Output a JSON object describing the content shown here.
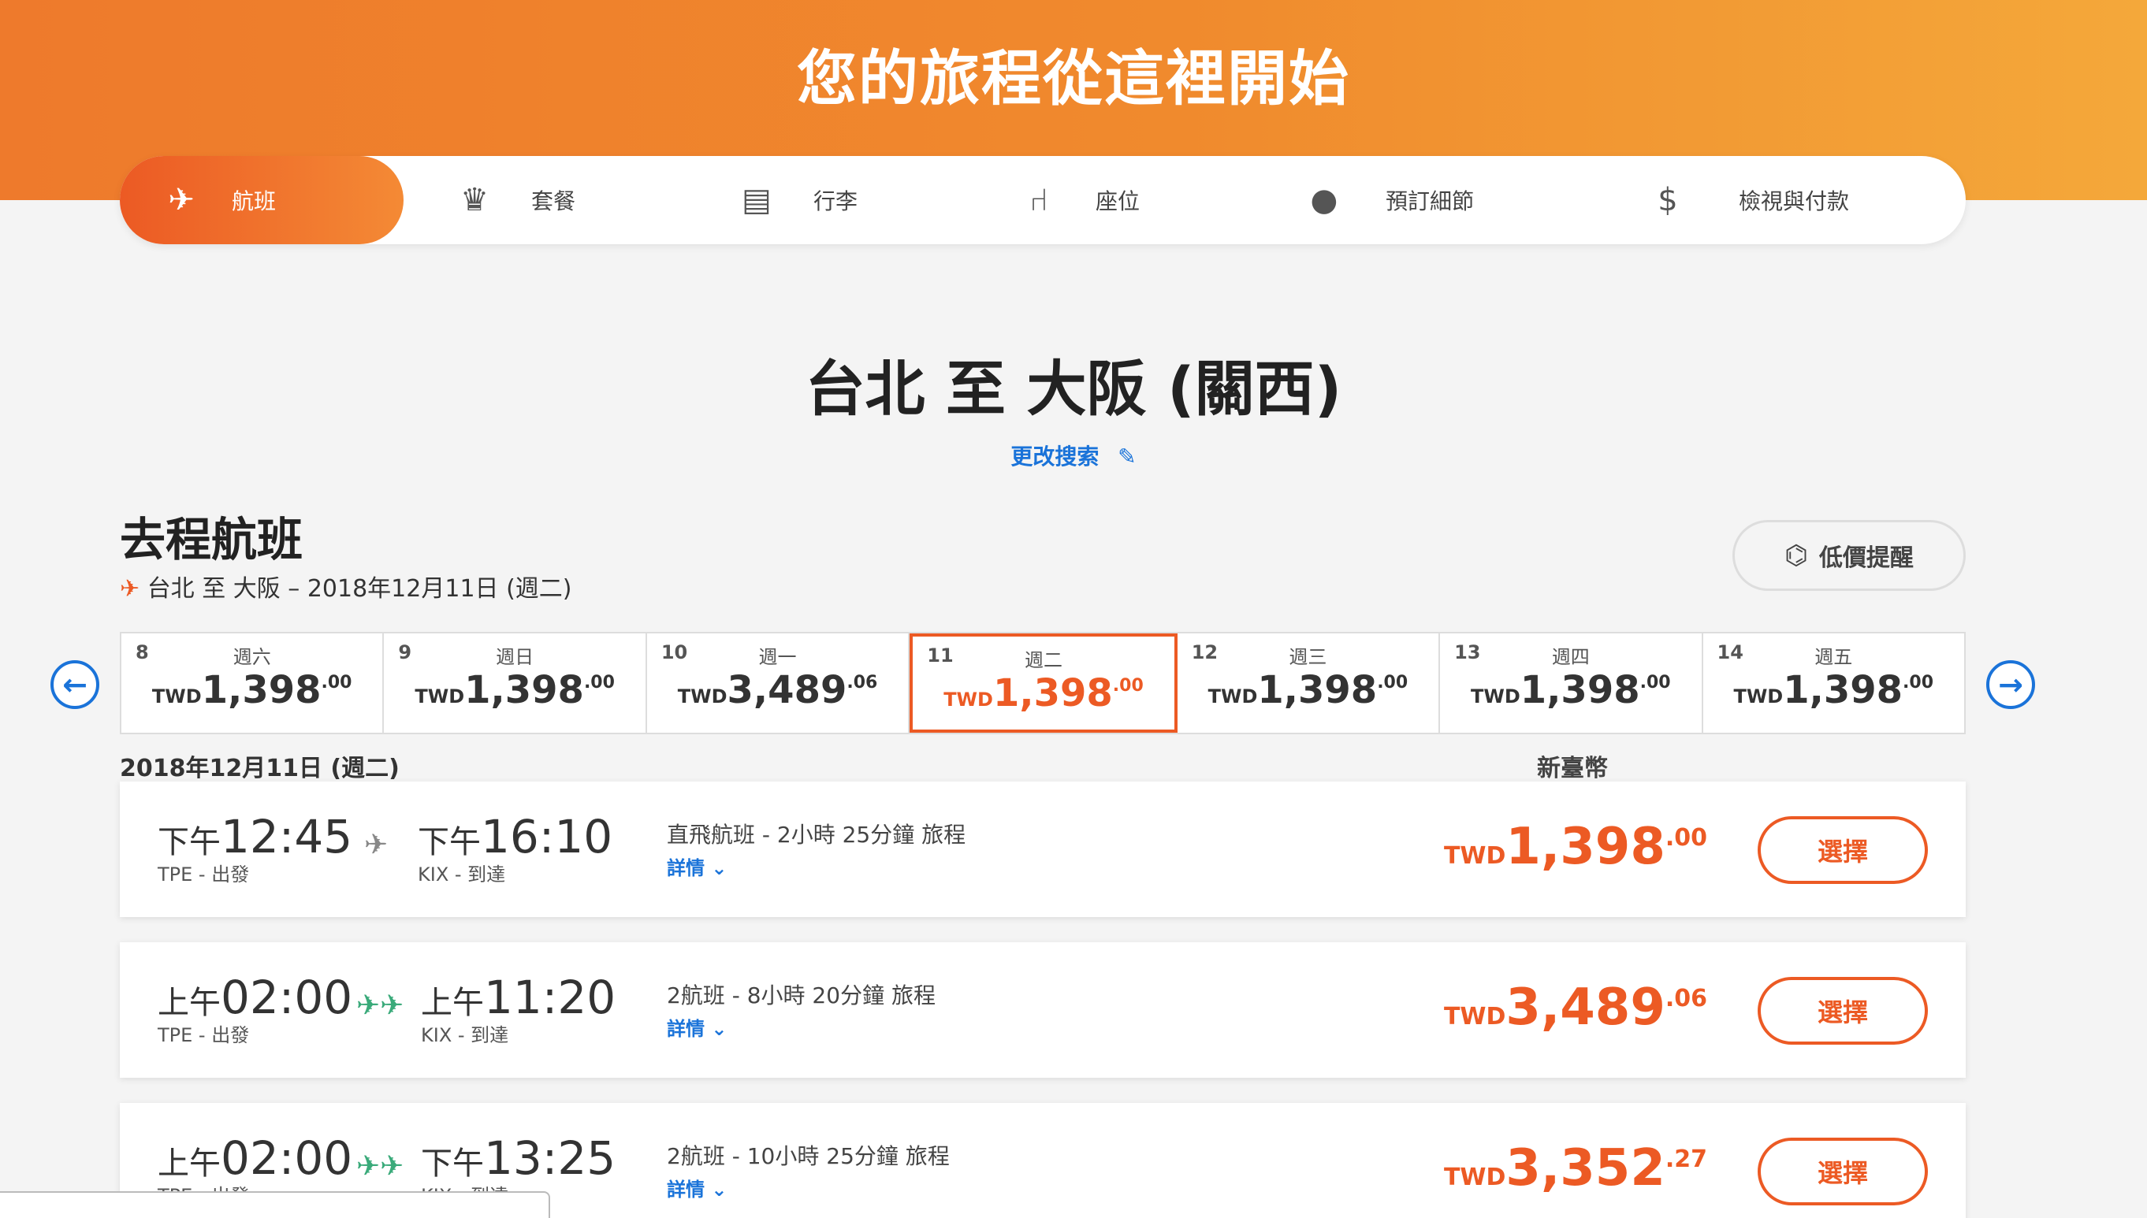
{
  "hero": {
    "title": "您的旅程從這裡開始"
  },
  "steps": [
    {
      "label": "航班",
      "icon": "✈"
    },
    {
      "label": "套餐",
      "icon": "♛"
    },
    {
      "label": "行李",
      "icon": "▤"
    },
    {
      "label": "座位",
      "icon": "⑁"
    },
    {
      "label": "預訂細節",
      "icon": "●"
    },
    {
      "label": "檢視與付款",
      "icon": "$"
    }
  ],
  "route": {
    "title": "台北 至 大阪 (關西)",
    "modify_label": "更改搜索",
    "modify_icon": "✎"
  },
  "outbound": {
    "title": "去程航班",
    "subtitle": "台北 至 大阪 – 2018年12月11日 (週二)",
    "alert_label": "低價提醒",
    "alert_icon": "⌬"
  },
  "date_nav": {
    "prev_icon": "←",
    "next_icon": "→"
  },
  "dates": [
    {
      "num": "8",
      "day": "週六",
      "currency": "TWD",
      "amount": "1,398",
      "decimal": ".00"
    },
    {
      "num": "9",
      "day": "週日",
      "currency": "TWD",
      "amount": "1,398",
      "decimal": ".00"
    },
    {
      "num": "10",
      "day": "週一",
      "currency": "TWD",
      "amount": "3,489",
      "decimal": ".06"
    },
    {
      "num": "11",
      "day": "週二",
      "currency": "TWD",
      "amount": "1,398",
      "decimal": ".00"
    },
    {
      "num": "12",
      "day": "週三",
      "currency": "TWD",
      "amount": "1,398",
      "decimal": ".00"
    },
    {
      "num": "13",
      "day": "週四",
      "currency": "TWD",
      "amount": "1,398",
      "decimal": ".00"
    },
    {
      "num": "14",
      "day": "週五",
      "currency": "TWD",
      "amount": "1,398",
      "decimal": ".00"
    }
  ],
  "list": {
    "date": "2018年12月11日 (週二)",
    "currency_label": "新臺幣"
  },
  "flights": [
    {
      "dep_ampm": "下午",
      "dep_time": "12:45",
      "dep_code": "TPE - 出發",
      "arr_ampm": "下午",
      "arr_time": "16:10",
      "arr_code": "KIX - 到達",
      "desc": "直飛航班 - 2小時 25分鐘 旅程",
      "detail": "詳情 ⌄",
      "currency": "TWD",
      "amount": "1,398",
      "decimal": ".00",
      "select_label": "選擇",
      "arrow_icon": "✈"
    },
    {
      "dep_ampm": "上午",
      "dep_time": "02:00",
      "dep_code": "TPE - 出發",
      "arr_ampm": "上午",
      "arr_time": "11:20",
      "arr_code": "KIX - 到達",
      "desc": "2航班 - 8小時 20分鐘 旅程",
      "detail": "詳情 ⌄",
      "currency": "TWD",
      "amount": "3,489",
      "decimal": ".06",
      "select_label": "選擇",
      "arrow_icon": "✈✈"
    },
    {
      "dep_ampm": "上午",
      "dep_time": "02:00",
      "dep_code": "TPE - 出發",
      "arr_ampm": "下午",
      "arr_time": "13:25",
      "arr_code": "KIX - 到達",
      "desc": "2航班 - 10小時 25分鐘 旅程",
      "detail": "詳情 ⌄",
      "currency": "TWD",
      "amount": "3,352",
      "decimal": ".27",
      "select_label": "選擇",
      "arrow_icon": "✈✈"
    }
  ],
  "colors": {
    "accent": "#ec5a24",
    "link": "#1a73d9",
    "connect": "#3aaa7a"
  }
}
